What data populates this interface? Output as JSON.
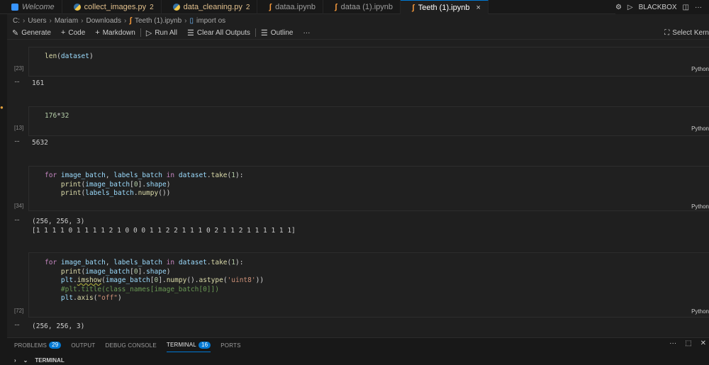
{
  "tabs": [
    {
      "label": "Welcome",
      "icon": "vscode-icon",
      "style": "italic"
    },
    {
      "label": "collect_images.py",
      "icon": "python-icon",
      "badge": "2",
      "style": "mod"
    },
    {
      "label": "data_cleaning.py",
      "icon": "python-icon",
      "badge": "2",
      "style": "mod"
    },
    {
      "label": "dataa.ipynb",
      "icon": "notebook-icon",
      "style": ""
    },
    {
      "label": "dataa (1).ipynb",
      "icon": "notebook-icon",
      "style": ""
    },
    {
      "label": "Teeth (1).ipynb",
      "icon": "notebook-icon",
      "style": "",
      "active": true,
      "close": "×"
    }
  ],
  "titlebar": {
    "account": "BLACKBOX"
  },
  "breadcrumb": {
    "root": "C:",
    "users": "Users",
    "user": "Mariam",
    "folder": "Downloads",
    "file": "Teeth (1).ipynb",
    "cell": "import os"
  },
  "toolbar": {
    "generate": "Generate",
    "code": "Code",
    "markdown": "Markdown",
    "run_all": "Run All",
    "clear_all": "Clear All Outputs",
    "outline": "Outline",
    "more": "···",
    "select_kernel": "Select Kern"
  },
  "cells": [
    {
      "count": "[23]",
      "lang": "Python",
      "output": "161"
    },
    {
      "count": "[13]",
      "lang": "Python",
      "output": "5632"
    },
    {
      "count": "[34]",
      "lang": "Python",
      "output_lines": [
        "(256, 256, 3)",
        "[1 1 1 1 0 1 1 1 1 2 1 0 0 0 1 1 2 2 1 1 1 0 2 1 1 2 1 1 1 1 1 1]"
      ]
    },
    {
      "count": "[72]",
      "lang": "Python",
      "output": "(256, 256, 3)"
    }
  ],
  "output_dots": "···",
  "panel": {
    "tabs": [
      {
        "label": "PROBLEMS",
        "badge": "29"
      },
      {
        "label": "OUTPUT"
      },
      {
        "label": "DEBUG CONSOLE"
      },
      {
        "label": "TERMINAL",
        "badge": "16",
        "active": true
      },
      {
        "label": "PORTS"
      }
    ],
    "terminal_label": "TERMINAL"
  }
}
